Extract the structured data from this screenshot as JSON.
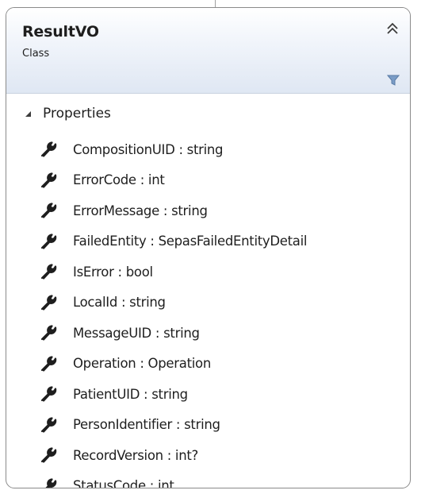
{
  "class": {
    "name": "ResultVO",
    "kind": "Class"
  },
  "icons": {
    "collapse": "double-chevron-up-icon",
    "filter": "filter-icon",
    "section_toggle": "triangle-expanded-icon",
    "property": "wrench-icon"
  },
  "colors": {
    "header_top": "#ffffff",
    "header_bottom": "#dfe7f3",
    "border": "#8a8a8a",
    "filter_icon": "#6f8fb5",
    "wrench_icon": "#1e1e1e"
  },
  "section": {
    "label": "Properties",
    "expanded": true
  },
  "properties": [
    {
      "text": "CompositionUID : string"
    },
    {
      "text": "ErrorCode : int"
    },
    {
      "text": "ErrorMessage : string"
    },
    {
      "text": "FailedEntity : SepasFailedEntityDetail"
    },
    {
      "text": "IsError : bool"
    },
    {
      "text": "LocalId : string"
    },
    {
      "text": "MessageUID : string"
    },
    {
      "text": "Operation : Operation"
    },
    {
      "text": "PatientUID : string"
    },
    {
      "text": "PersonIdentifier : string"
    },
    {
      "text": "RecordVersion : int?"
    },
    {
      "text": "StatusCode : int"
    }
  ]
}
